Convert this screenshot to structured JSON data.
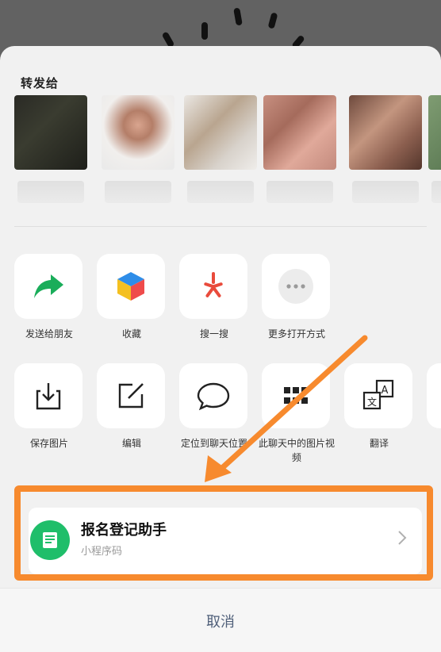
{
  "share_sheet": {
    "forward_title": "转发给",
    "actions_row1": [
      {
        "label": "发送给朋友",
        "icon": "share-arrow-icon"
      },
      {
        "label": "收藏",
        "icon": "collection-cube-icon"
      },
      {
        "label": "搜一搜",
        "icon": "search-star-icon"
      },
      {
        "label": "更多打开方式",
        "icon": "more-dots-icon"
      }
    ],
    "actions_row2": [
      {
        "label": "保存图片",
        "icon": "save-download-icon"
      },
      {
        "label": "编辑",
        "icon": "edit-pen-icon"
      },
      {
        "label": "定位到聊天位置",
        "icon": "chat-bubble-icon"
      },
      {
        "label": "此聊天中的图片视频",
        "icon": "grid-icon"
      },
      {
        "label": "翻译",
        "icon": "translate-icon"
      }
    ],
    "mini_program": {
      "title": "报名登记助手",
      "subtitle": "小程序码"
    },
    "cancel_label": "取消"
  },
  "colors": {
    "highlight": "#f78a2e",
    "arrow": "#f78a2e",
    "share_green": "#1aad5a",
    "search_red": "#e94b3c",
    "mini_program_green": "#1fbe6a"
  }
}
